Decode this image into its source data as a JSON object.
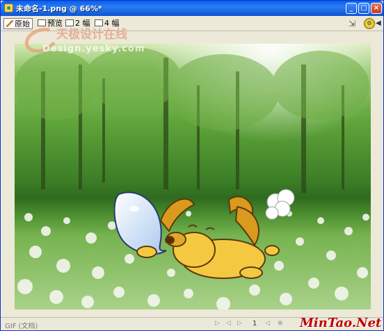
{
  "window": {
    "title": "未命名-1.png @ 66%*",
    "buttons": {
      "minimize": "_",
      "maximize": "□",
      "close": "×"
    }
  },
  "toolbar": {
    "tabs": [
      {
        "label": "原始",
        "active": true,
        "icon": "pencil-icon"
      },
      {
        "label": "预览",
        "active": false,
        "icon": "preview-icon"
      },
      {
        "label": "2 幅",
        "active": false,
        "icon": "two-up-icon"
      },
      {
        "label": "4 幅",
        "active": false,
        "icon": "four-up-icon"
      }
    ],
    "right_icons": [
      "pointer-tool-icon",
      "export-wizard-icon",
      "arrow-icon"
    ]
  },
  "watermark": {
    "cn": "天极设计在线",
    "en": "Design.yesky.com"
  },
  "canvas": {
    "description_icons": [
      "speech-bubble-icon",
      "puppy-icon",
      "cloud-puff-icon"
    ],
    "colors": {
      "dog": "#f5c842",
      "ears": "#d99a1e",
      "bubble": "#dbe9fb"
    }
  },
  "statusbar": {
    "format": "GIF (文档)",
    "frame": "1",
    "brand": "MinTao.Net"
  }
}
